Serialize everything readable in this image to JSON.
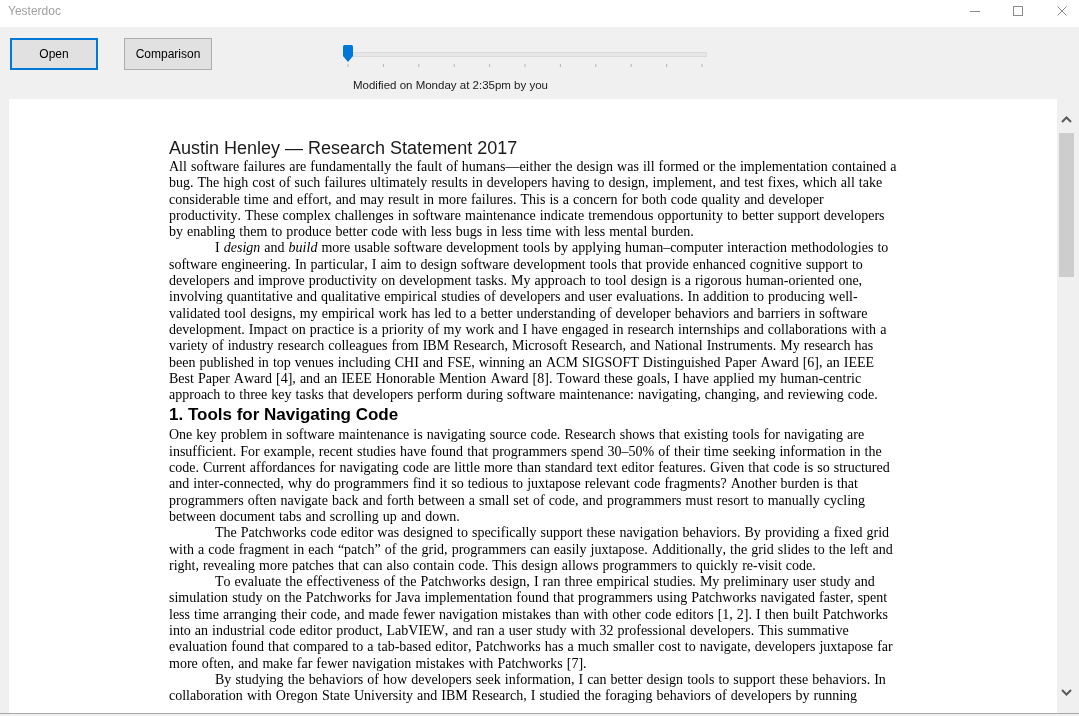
{
  "window": {
    "title": "Yesterdoc"
  },
  "toolbar": {
    "buttons": [
      {
        "label": "Open",
        "focused": true
      },
      {
        "label": "Comparison",
        "focused": false
      }
    ],
    "history_slider": {
      "level": 0,
      "caption": "Modified on Monday at 2:35pm by you"
    }
  },
  "document": {
    "blocks": [
      {
        "kind": "title",
        "text": "Austin Henley — Research Statement 2017"
      },
      {
        "kind": "paragraph",
        "indented": false,
        "text": "All software failures are fundamentally the fault of humans—either the design was ill formed or the implementation contained a bug. The high cost of such failures ultimately results in developers having to design, implement, and test fixes, which all take considerable time and effort, and may result in more failures. This is a concern for both code quality and developer productivity. These complex challenges in software maintenance indicate tremendous opportunity to better support developers by enabling them to produce better code with less bugs in less time with less mental burden."
      },
      {
        "kind": "paragraph",
        "indented": true,
        "text": "I *design* and *build* more usable software development tools by applying human–computer interaction methodologies to software engineering. In particular, I aim to design software development tools that provide enhanced cognitive support to developers and improve productivity on development tasks. My approach to tool design is a rigorous human-oriented one, involving quantitative and qualitative empirical studies of developers and user evaluations. In addition to producing well-validated tool designs, my empirical work has led to a better understanding of developer behaviors and barriers in software development. Impact on practice is a priority of my work and I have engaged in research internships and collaborations with a variety of industry research colleagues from IBM Research, Microsoft Research, and National Instruments. My research has been published in top venues including CHI and FSE, winning an ACM SIGSOFT Distinguished Paper Award [6], an IEEE Best Paper Award [4], and an IEEE Honorable Mention Award [8]. Toward these goals, I have applied my human-centric approach to three key tasks that developers perform during software maintenance: navigating, changing, and reviewing code."
      },
      {
        "kind": "heading",
        "text": "1. Tools for Navigating Code"
      },
      {
        "kind": "paragraph",
        "indented": false,
        "text": "One key problem in software maintenance is navigating source code. Research shows that existing tools for navigating are insufficient. For example, recent studies have found that programmers spend 30–50% of their time seeking information in the code. Current affordances for navigating code are little more than standard text editor features. Given that code is so structured and inter-connected, why do programmers find it so tedious to juxtapose relevant code fragments? Another burden is that programmers often navigate back and forth between a small set of code, and programmers must resort to manually cycling between document tabs and scrolling up and down."
      },
      {
        "kind": "paragraph",
        "indented": true,
        "text": "The Patchworks code editor was designed to specifically support these navigation behaviors. By providing a fixed grid with a code fragment in each “patch” of the grid, programmers can easily juxtapose. Additionally, the grid slides to the left and right, revealing more patches that can also contain code. This design allows programmers to quickly re-visit code."
      },
      {
        "kind": "paragraph",
        "indented": true,
        "text": "To evaluate the effectiveness of the Patchworks design, I ran three empirical studies. My preliminary user study and simulation study on the Patchworks for Java implementation found that programmers using Patchworks navigated faster, spent less time arranging their code, and made fewer navigation mistakes than with other code editors [1, 2]. I then built Patchworks into an industrial code editor product, LabVIEW, and ran a user study with 32 professional developers. This summative evaluation found that compared to a tab-based editor, Patchworks has a much smaller cost to navigate, developers juxtapose far more often, and make far fewer navigation mistakes with Patchworks [7]."
      },
      {
        "kind": "paragraph",
        "indented": true,
        "text": "By studying the behaviors of how developers seek information, I can better design tools to support these behaviors. In collaboration with Oregon State University and IBM Research, I studied the foraging behaviors of developers by running"
      }
    ]
  }
}
